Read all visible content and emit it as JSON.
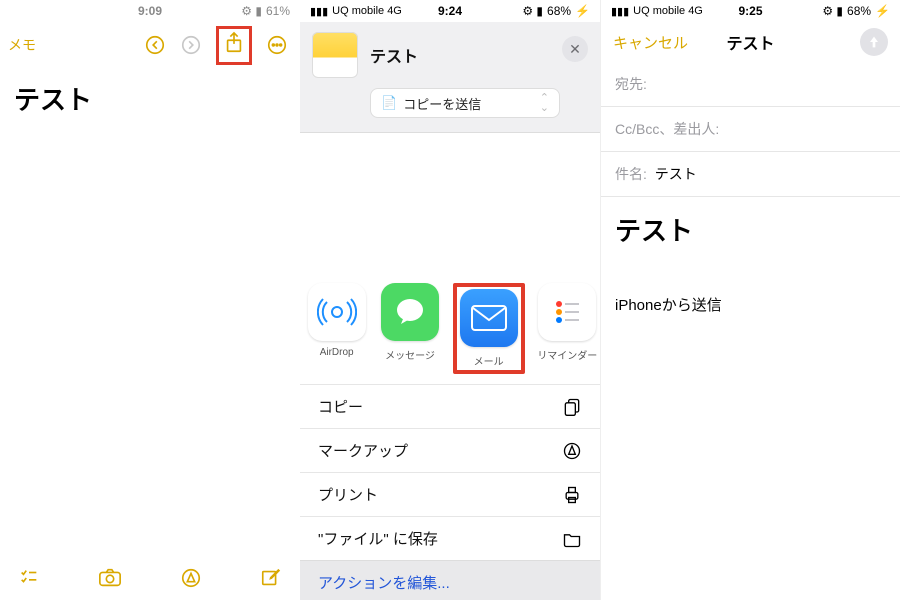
{
  "pane1": {
    "status_time": "9:09",
    "status_batt": "61%",
    "back_label": "メモ",
    "title": "テスト"
  },
  "pane2": {
    "status_carrier": "UQ mobile  4G",
    "status_time": "9:24",
    "status_batt": "68%",
    "sheet_title": "テスト",
    "dropdown_label": "コピーを送信",
    "apps": {
      "airdrop": "AirDrop",
      "messages": "メッセージ",
      "mail": "メール",
      "reminders": "リマインダー"
    },
    "actions": {
      "copy": "コピー",
      "markup": "マークアップ",
      "print": "プリント",
      "save_files": "\"ファイル\" に保存"
    },
    "edit_actions": "アクションを編集..."
  },
  "pane3": {
    "status_carrier": "UQ mobile  4G",
    "status_time": "9:25",
    "status_batt": "68%",
    "cancel": "キャンセル",
    "nav_title": "テスト",
    "to_label": "宛先:",
    "cc_label": "Cc/Bcc、差出人:",
    "subject_label": "件名:",
    "subject_value": "テスト",
    "body_title": "テスト",
    "signature": "iPhoneから送信"
  }
}
